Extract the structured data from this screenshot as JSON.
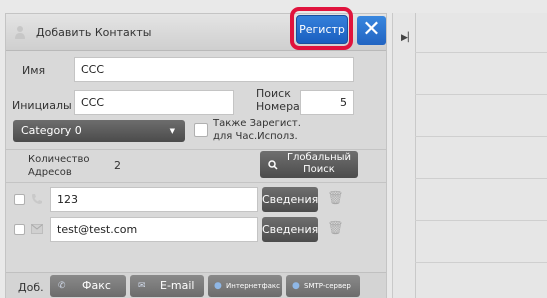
{
  "dialog": {
    "title": "Добавить Контакты",
    "register_button": "Регистр",
    "close_glyph": "✕"
  },
  "form": {
    "name_label": "Имя",
    "name_value": "CCC",
    "initials_label": "Инициалы",
    "initials_value": "CCC",
    "search_number_label": "Поиск Номера",
    "search_number_value": "5",
    "category_value": "Category 0",
    "also_register_label": "Также Зарегист. для Час.Исполз.",
    "address_count_label": "Количество Адресов",
    "address_count_value": "2",
    "global_search_button": "Глобальный Поиск"
  },
  "addresses": [
    {
      "value": "123",
      "type_icon": "phone-icon",
      "details_button": "Сведения"
    },
    {
      "value": "test@test.com",
      "type_icon": "email-icon",
      "details_button": "Сведения"
    }
  ],
  "bottom_bar": {
    "add_label": "Доб.",
    "fax_button": "Факс",
    "email_button": "E-mail",
    "ifax_button": "Интернетфакс",
    "smtp_button": "SMTP-сервер"
  },
  "colors": {
    "accent_blue": "#2a6fd0",
    "highlight_red": "#e0133d"
  }
}
